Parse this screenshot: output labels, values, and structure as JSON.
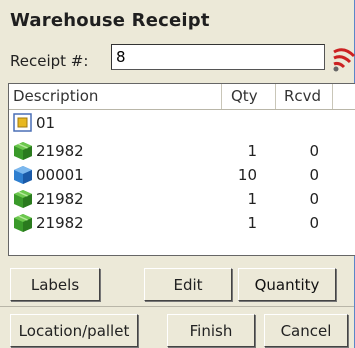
{
  "title": "Warehouse Receipt",
  "receipt": {
    "label": "Receipt #:",
    "value": "8"
  },
  "columns": {
    "description": "Description",
    "qty": "Qty",
    "rcvd": "Rcvd"
  },
  "rows": [
    {
      "icon": "package-folder-icon",
      "description": "01",
      "qty": "",
      "rcvd": ""
    },
    {
      "icon": "green-box-icon",
      "description": "21982",
      "qty": "1",
      "rcvd": "0"
    },
    {
      "icon": "blue-box-icon",
      "description": "00001",
      "qty": "10",
      "rcvd": "0"
    },
    {
      "icon": "green-box-icon",
      "description": "21982",
      "qty": "1",
      "rcvd": "0"
    },
    {
      "icon": "green-box-icon",
      "description": "21982",
      "qty": "1",
      "rcvd": "0"
    }
  ],
  "buttons": {
    "labels": "Labels",
    "edit": "Edit",
    "quantity": "Quantity",
    "location": "Location/pallet",
    "finish": "Finish",
    "cancel": "Cancel"
  },
  "colors": {
    "background": "#ece9d8",
    "frame": "#5b86c9",
    "green_box": "#3a9a2a",
    "blue_box": "#2e7fd0",
    "signal": "#cc2222"
  }
}
